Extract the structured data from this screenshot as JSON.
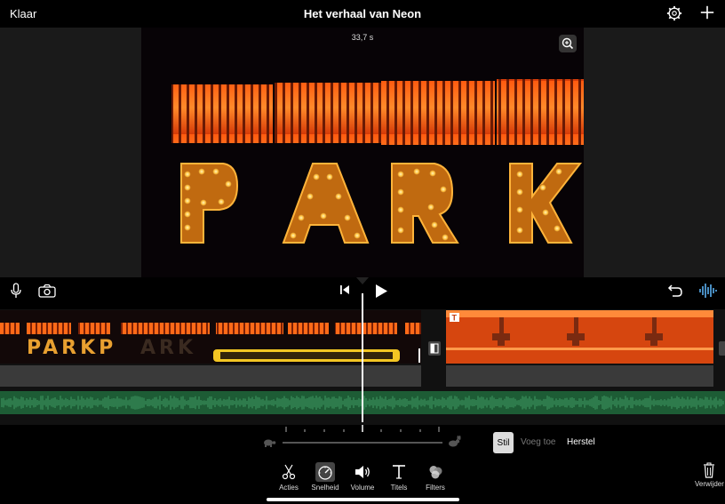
{
  "topbar": {
    "done_label": "Klaar",
    "project_title": "Het verhaal van Neon",
    "settings_icon": "gear-icon",
    "add_icon": "plus-icon"
  },
  "viewer": {
    "duration": "33,7 s",
    "zoom_icon": "zoom-icon",
    "frame_text": "PARK"
  },
  "transport": {
    "mic_icon": "microphone-icon",
    "camera_icon": "camera-icon",
    "rewind_icon": "skip-to-start-icon",
    "play_icon": "play-icon",
    "undo_icon": "undo-icon",
    "audio_icon": "waveform-icon"
  },
  "timeline": {
    "clip1_text": "PARKP",
    "clip1_faded_text": "ARK"
  },
  "speed": {
    "slow_icon": "turtle-icon",
    "fast_icon": "rabbit-icon",
    "freeze_label": "Stil",
    "add_label": "Voeg toe",
    "reset_label": "Herstel"
  },
  "tabs": [
    {
      "label": "Acties",
      "icon": "scissors-icon"
    },
    {
      "label": "Snelheid",
      "icon": "speedometer-icon"
    },
    {
      "label": "Volume",
      "icon": "speaker-icon"
    },
    {
      "label": "Titels",
      "icon": "text-icon"
    },
    {
      "label": "Filters",
      "icon": "filters-icon"
    }
  ],
  "delete_label": "Verwijder",
  "colors": {
    "accent_yellow": "#f3c623",
    "audio_green": "#1d5c35",
    "waveform_blue": "#5ab0f0"
  }
}
